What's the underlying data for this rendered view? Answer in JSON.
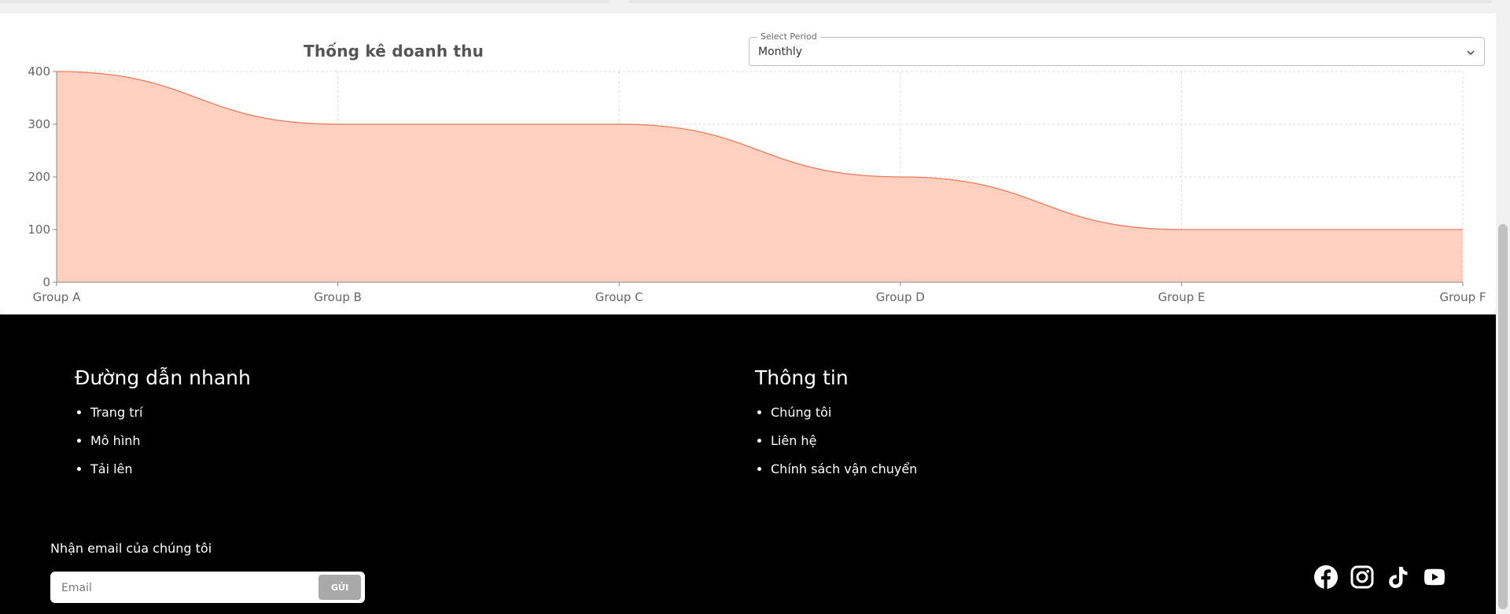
{
  "card": {
    "title": "Thống kê doanh thu",
    "period_select": {
      "legend": "Select Period",
      "value": "Monthly"
    }
  },
  "chart_data": {
    "type": "area",
    "title": "Thống kê doanh thu",
    "categories": [
      "Group A",
      "Group B",
      "Group C",
      "Group D",
      "Group E",
      "Group F"
    ],
    "values": [
      400,
      300,
      300,
      200,
      100,
      100
    ],
    "yticks": [
      "0",
      "100",
      "200",
      "300",
      "400"
    ],
    "ylim": [
      0,
      400
    ],
    "grid": true,
    "stroke_color": "#f07a5a",
    "fill_color": "#ffcfc0",
    "xlabel": "",
    "ylabel": ""
  },
  "footer": {
    "quick_links": {
      "heading": "Đường dẫn nhanh",
      "items": [
        "Trang trí",
        "Mô hình",
        "Tải lên"
      ]
    },
    "info": {
      "heading": "Thông tin",
      "items": [
        "Chúng tôi",
        "Liên hệ",
        "Chính sách vận chuyển"
      ]
    },
    "newsletter": {
      "label": "Nhận email của chúng tôi",
      "placeholder": "Email",
      "button": "GỬI"
    },
    "socials": [
      "facebook-icon",
      "instagram-icon",
      "tiktok-icon",
      "youtube-icon"
    ]
  }
}
